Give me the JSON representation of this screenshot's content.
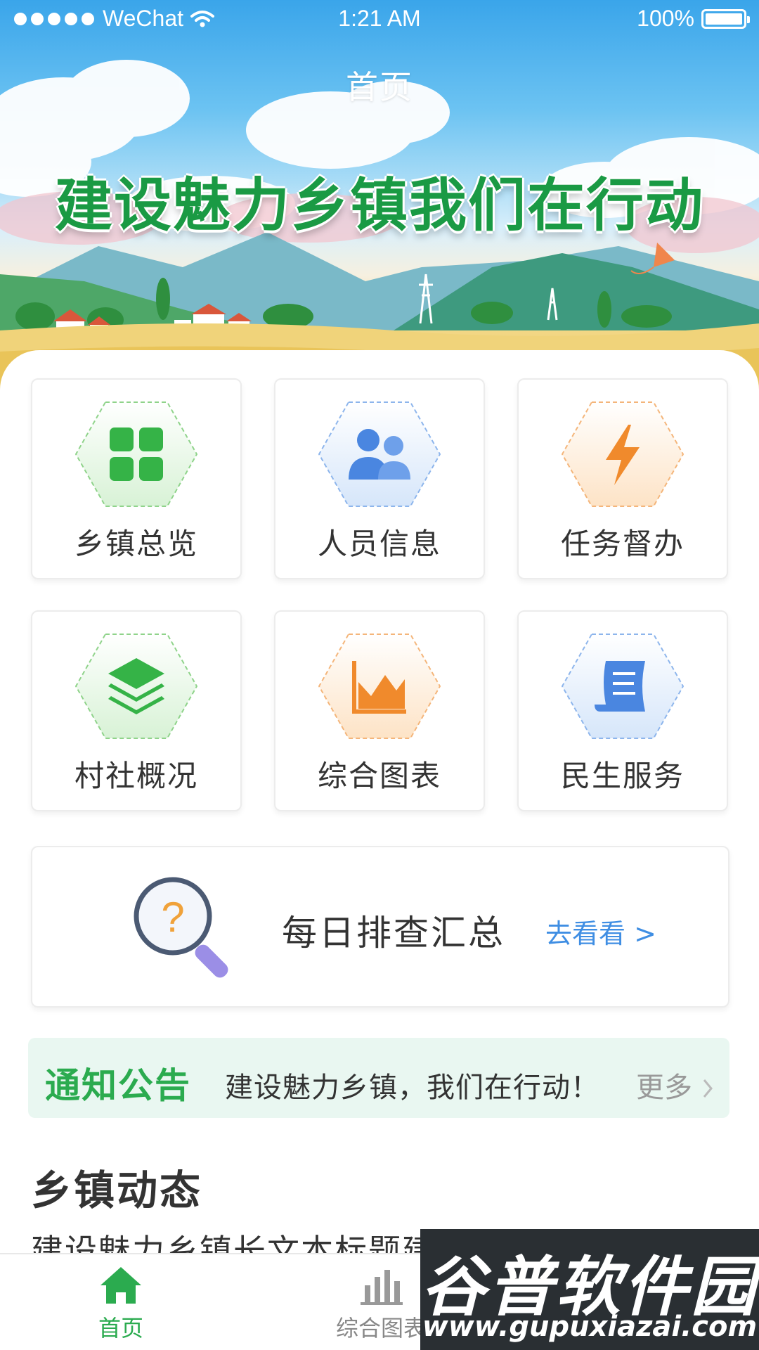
{
  "status_bar": {
    "carrier": "WeChat",
    "time": "1:21 AM",
    "battery": "100%"
  },
  "header": {
    "title": "首页",
    "banner_slogan": "建设魅力乡镇我们在行动"
  },
  "menu": {
    "items": [
      {
        "label": "乡镇总览",
        "icon": "grid-apps-icon",
        "accent": "#35b347"
      },
      {
        "label": "人员信息",
        "icon": "users-icon",
        "accent": "#4a86e0"
      },
      {
        "label": "任务督办",
        "icon": "lightning-icon",
        "accent": "#f08a2c"
      },
      {
        "label": "村社概况",
        "icon": "layers-icon",
        "accent": "#35b347"
      },
      {
        "label": "综合图表",
        "icon": "area-chart-icon",
        "accent": "#f08a2c"
      },
      {
        "label": "民生服务",
        "icon": "scroll-icon",
        "accent": "#4a86e0"
      }
    ]
  },
  "daily_check": {
    "title": "每日排查汇总",
    "link": "去看看 >",
    "icon": "magnifier-question-icon"
  },
  "notice": {
    "label": "通知公告",
    "text": "建设魅力乡镇，我们在行动！",
    "more": "更多"
  },
  "news": {
    "section_title": "乡镇动态",
    "first_title": "建设魅力乡镇长文本标题建设美丽新村长"
  },
  "tabbar": {
    "items": [
      {
        "label": "首页",
        "icon": "home-icon",
        "active": true
      },
      {
        "label": "综合图表",
        "icon": "bar-chart-icon",
        "active": false
      }
    ],
    "active_color": "#2bab4f",
    "inactive_color": "#888888"
  },
  "watermark": {
    "brand": "谷普软件园",
    "url": "www.gupuxiazai.com"
  }
}
